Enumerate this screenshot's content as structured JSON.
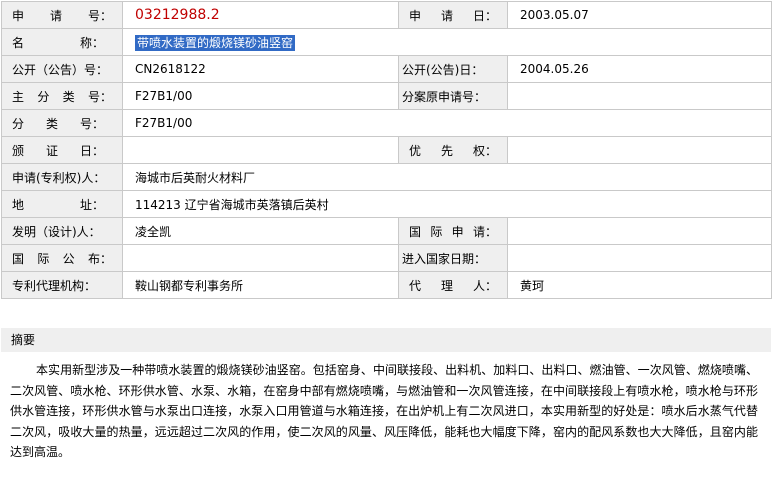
{
  "rows": [
    {
      "l1": "申请号：",
      "v1": "03212988.2",
      "l2": "申请日：",
      "v2": "2003.05.07"
    },
    {
      "l1": "名称：",
      "v1": "带喷水装置的煅烧镁砂油竖窑"
    },
    {
      "l1": "公开（公告）号：",
      "v1": "CN2618122",
      "l2": "公开(公告)日：",
      "v2": "2004.05.26"
    },
    {
      "l1": "主分类号：",
      "v1": "F27B1/00",
      "l2": "分案原申请号：",
      "v2": ""
    },
    {
      "l1": "分类号：",
      "v1": "F27B1/00"
    },
    {
      "l1": "颁证日：",
      "v1": "",
      "l2": "优先权：",
      "v2": ""
    },
    {
      "l1": "申请(专利权)人：",
      "v1": "海城市后英耐火材料厂"
    },
    {
      "l1": "地址：",
      "v1": "114213 辽宁省海城市英落镇后英村"
    },
    {
      "l1": "发明（设计)人：",
      "v1": "凌全凯",
      "l2": "国际申请：",
      "v2": ""
    },
    {
      "l1": "国际公布：",
      "v1": "",
      "l2": "进入国家日期：",
      "v2": ""
    },
    {
      "l1": "专利代理机构：",
      "v1": "鞍山钢都专利事务所",
      "l2": "代理人：",
      "v2": "黄珂"
    }
  ],
  "abstract": {
    "title": "摘要",
    "text": "本实用新型涉及一种带喷水装置的煅烧镁砂油竖窑。包括窑身、中间联接段、出料机、加料口、出料口、燃油管、一次风管、燃烧喷嘴、二次风管、喷水枪、环形供水管、水泵、水箱，在窑身中部有燃烧喷嘴，与燃油管和一次风管连接，在中间联接段上有喷水枪，喷水枪与环形供水管连接，环形供水管与水泵出口连接，水泵入口用管道与水箱连接，在出炉机上有二次风进口，本实用新型的好处是：喷水后水蒸气代替二次风，吸收大量的热量，远远超过二次风的作用，使二次风的风量、风压降低，能耗也大幅度下降，窑内的配风系数也大大降低，且窑内能达到高温。"
  }
}
